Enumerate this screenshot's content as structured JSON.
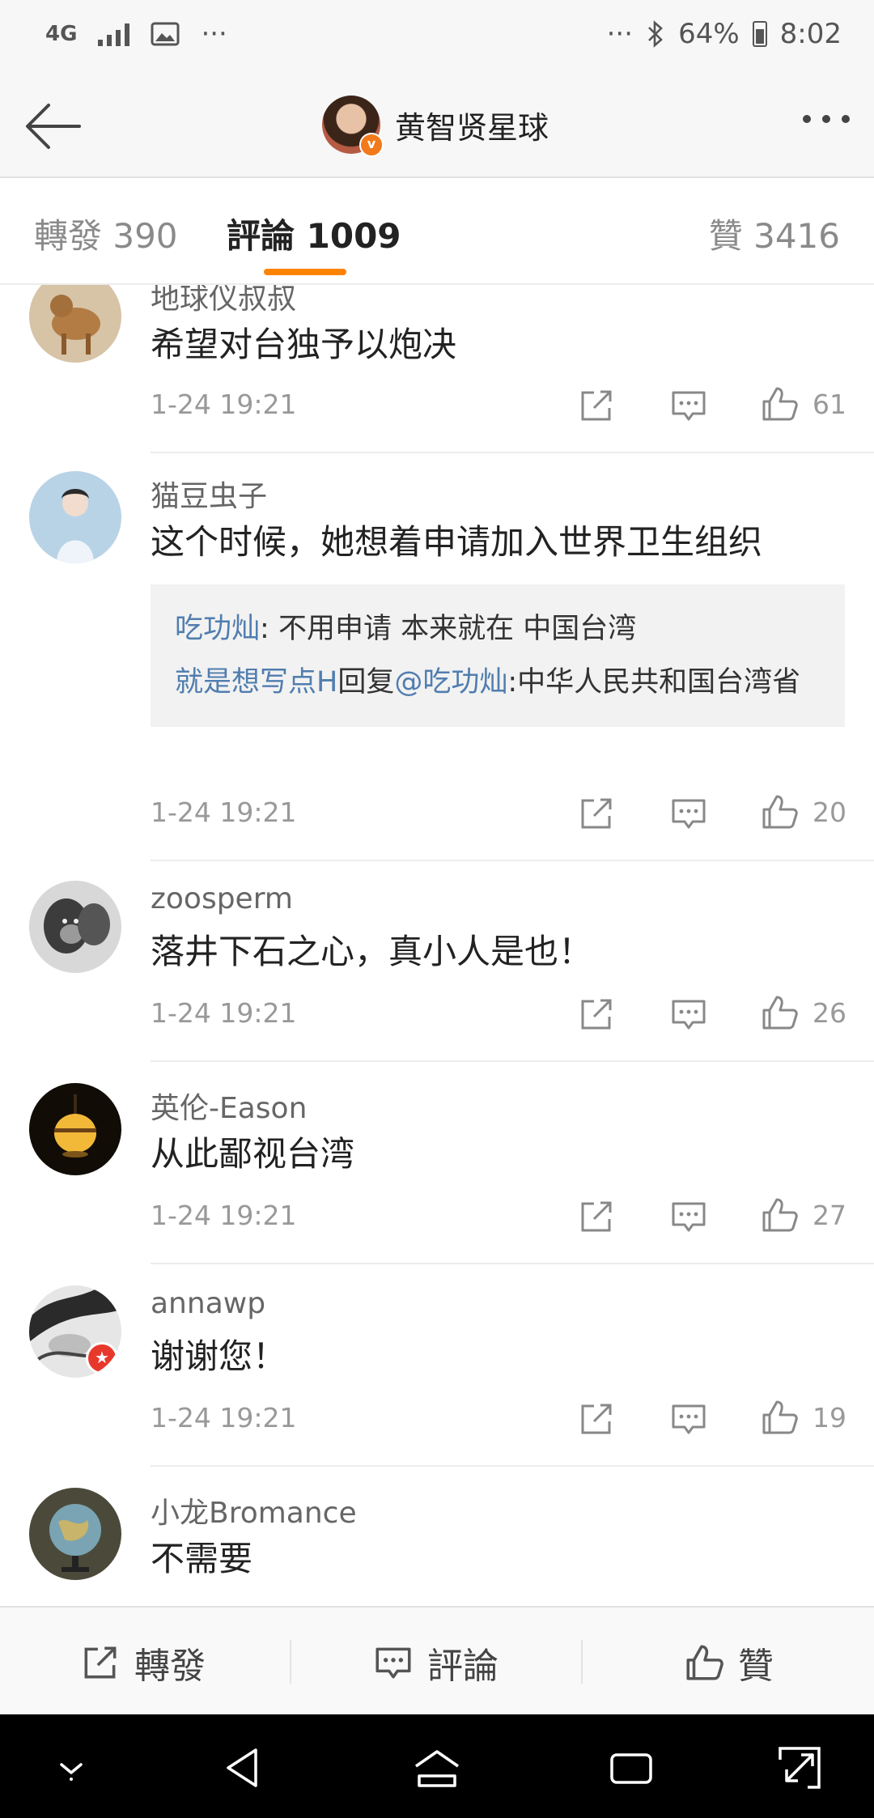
{
  "status_bar": {
    "network": "4G",
    "left_overflow": "···",
    "right_overflow": "···",
    "battery": "64%",
    "time": "8:02",
    "icons": [
      "signal-bars-icon",
      "image-icon",
      "bluetooth-icon",
      "battery-icon"
    ]
  },
  "header": {
    "title": "黄智贤星球",
    "verified_badge": "v"
  },
  "tabs": {
    "repost": "轉發 390",
    "comments": "評論 1009",
    "likes": "贊 3416"
  },
  "comments": [
    {
      "user": "地球仪叔叔",
      "text": "希望对台独予以炮决",
      "time": "1-24 19:21",
      "likes": "61"
    },
    {
      "user": "猫豆虫子",
      "text": "这个时候，她想着申请加入世界卫生组织",
      "replies": [
        {
          "author": "吃功灿",
          "sep": ": ",
          "text": "不用申请  本来就在 中国台湾"
        },
        {
          "author": "就是想写点H",
          "mid": "回复",
          "mention": "@吃功灿",
          "sep": ":",
          "text": "中华人民共和国台湾省"
        }
      ],
      "time": "1-24 19:21",
      "likes": "20"
    },
    {
      "user": "zoosperm",
      "text": "落井下石之心，真小人是也！",
      "time": "1-24 19:21",
      "likes": "26"
    },
    {
      "user": "英伦-Eason",
      "text": "从此鄙视台湾",
      "time": "1-24 19:21",
      "likes": "27"
    },
    {
      "user": "annawp",
      "text": "谢谢您！",
      "time": "1-24 19:21",
      "likes": "19"
    },
    {
      "user": "小龙Bromance",
      "text": "不需要"
    }
  ],
  "action_bar": {
    "repost": "轉發",
    "comment": "評論",
    "like": "贊"
  },
  "colors": {
    "accent_orange": "#ff8200",
    "link_blue": "#507daf",
    "verified_badge": "#f27a1a"
  }
}
